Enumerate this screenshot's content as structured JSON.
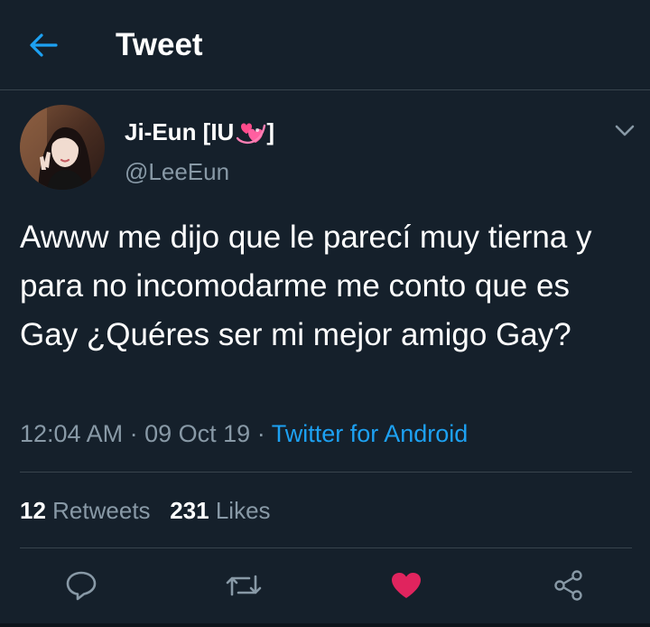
{
  "header": {
    "title": "Tweet"
  },
  "tweet": {
    "display_name": "Ji-Eun [IU",
    "display_name_end": "]",
    "display_name_emoji": "revolving-hearts-emoji",
    "username": "@LeeEun",
    "text": "Awww me dijo que le parecí muy tierna y para no incomodarme me conto que es Gay ¿Quéres ser mi mejor amigo Gay?",
    "time": "12:04 AM",
    "date": "09 Oct 19",
    "separator": "·",
    "source": "Twitter for Android"
  },
  "stats": {
    "retweets_count": "12",
    "retweets_label": "Retweets",
    "likes_count": "231",
    "likes_label": "Likes"
  },
  "icons": {
    "back": "back-arrow-icon",
    "caret": "chevron-down-icon",
    "reply": "reply-icon",
    "retweet": "retweet-icon",
    "like": "heart-icon",
    "share": "share-icon"
  },
  "colors": {
    "background": "#15202b",
    "accent": "#1da1f2",
    "muted": "#8899a6",
    "like": "#e0245e",
    "divider": "#38444d"
  },
  "liked": true
}
